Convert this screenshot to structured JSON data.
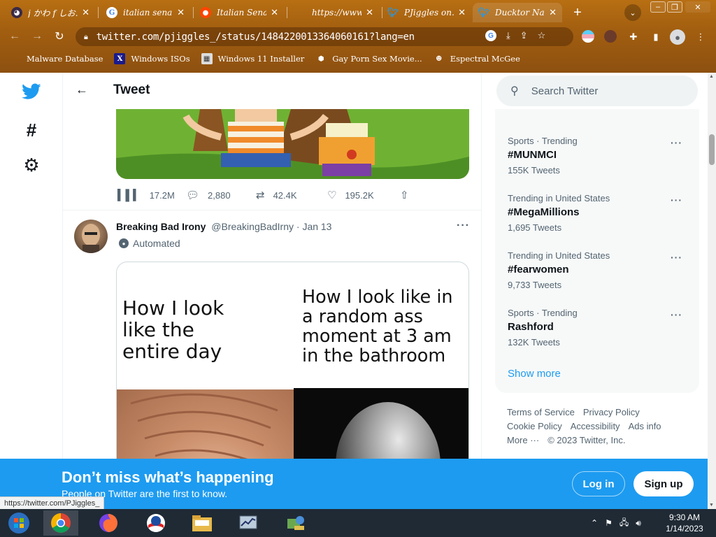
{
  "browser": {
    "tabs": [
      {
        "title": "j かわ f しお…",
        "favicon": "anime-avatar-icon"
      },
      {
        "title": "italian senate…",
        "favicon": "google-icon"
      },
      {
        "title": "Italian Senat…",
        "favicon": "reddit-icon"
      },
      {
        "title": "https://www…",
        "favicon": "blank-icon"
      },
      {
        "title": "PJiggles on…",
        "favicon": "twitter-icon"
      },
      {
        "title": "Ducktor Nalu…",
        "favicon": "twitter-icon",
        "active": true
      }
    ],
    "url": "twitter.com/pjiggles_/status/1484220013364060161?lang=en",
    "bookmarks": [
      {
        "label": "Malware Database"
      },
      {
        "label": "Windows ISOs"
      },
      {
        "label": "Windows 11 Installer"
      },
      {
        "label": "Gay Porn Sex Movie..."
      },
      {
        "label": "Espectral McGee"
      }
    ],
    "status_url": "https://twitter.com/PJiggles_"
  },
  "header": {
    "title": "Tweet"
  },
  "tweet1": {
    "views": "17.2M",
    "replies": "2,880",
    "retweets": "42.4K",
    "likes": "195.2K"
  },
  "tweet2": {
    "name": "Breaking Bad Irony",
    "handle": "@BreakingBadIrny",
    "sep": "·",
    "date": "Jan 13",
    "automated": "Automated",
    "meme_left": "How I look like the entire day",
    "meme_right": "How I look like in a random ass moment at 3 am in the bathroom"
  },
  "search": {
    "placeholder": "Search Twitter"
  },
  "trends": [
    {
      "context": "Sports · Trending",
      "tag": "#MUNMCI",
      "count": "155K Tweets"
    },
    {
      "context": "Trending in United States",
      "tag": "#MegaMillions",
      "count": "1,695 Tweets"
    },
    {
      "context": "Trending in United States",
      "tag": "#fearwomen",
      "count": "9,733 Tweets"
    },
    {
      "context": "Sports · Trending",
      "tag": "Rashford",
      "count": "132K Tweets"
    }
  ],
  "show_more": "Show more",
  "footer": {
    "links": [
      "Terms of Service",
      "Privacy Policy",
      "Cookie Policy",
      "Accessibility",
      "Ads info",
      "More ···"
    ],
    "copyright": "© 2023 Twitter, Inc."
  },
  "banner": {
    "headline": "Don’t miss what’s happening",
    "sub": "People on Twitter are the first to know.",
    "login": "Log in",
    "signup": "Sign up"
  },
  "taskbar": {
    "time": "9:30 AM",
    "date": "1/14/2023"
  },
  "colors": {
    "twitter_blue": "#1d9bf0",
    "chrome_frame": "#a35f10"
  }
}
